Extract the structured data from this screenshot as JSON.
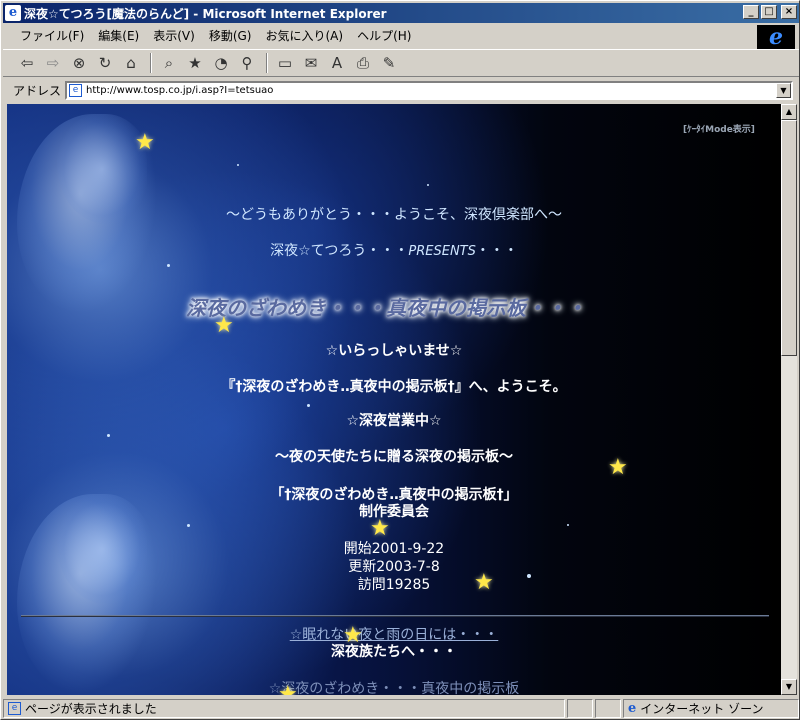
{
  "window": {
    "title": "深夜☆てつろう[魔法のらんど] - Microsoft Internet Explorer",
    "minimize": "_",
    "maximize": "□",
    "close": "×"
  },
  "menu": [
    "ファイル(F)",
    "編集(E)",
    "表示(V)",
    "移動(G)",
    "お気に入り(A)",
    "ヘルプ(H)"
  ],
  "toolbar_icons": [
    "back-icon",
    "forward-icon",
    "stop-icon",
    "refresh-icon",
    "home-icon",
    "search-icon",
    "favorites-icon",
    "history-icon",
    "channels-icon",
    "fullscreen-icon",
    "mail-icon",
    "font-icon",
    "print-icon",
    "edit-icon"
  ],
  "address": {
    "label": "アドレス",
    "url": "http://www.tosp.co.jp/i.asp?I=tetsuao"
  },
  "page": {
    "keitai_link": "[ｹｰﾀｲMode表示]",
    "greeting1": "～どうもありがとう・・・ようこそ、深夜倶楽部へ～",
    "greeting2_prefix": "深夜☆てつろう・・・",
    "greeting2_presents": "PRESENTS",
    "greeting2_suffix": "・・・",
    "title": "深夜のざわめき・・・真夜中の掲示板・・・",
    "welcome": "☆いらっしゃいませ☆",
    "intro": "『†深夜のざわめき‥真夜中の掲示板†』へ、ようこそ。",
    "open": "☆深夜営業中☆",
    "tagline": "～夜の天使たちに贈る深夜の掲示板～",
    "committee_line1": "「†深夜のざわめき‥真夜中の掲示板†」",
    "committee_line2": "制作委員会",
    "start": "開始2001-9-22",
    "update": "更新2003-7-8",
    "visits": "訪問19285",
    "link1": "☆眠れない夜と雨の日には・・・",
    "tribe": "深夜族たちへ・・・",
    "link2": "☆深夜のざわめき・・・真夜中の掲示板"
  },
  "status": {
    "message": "ページが表示されました",
    "zone": "インターネット ゾーン"
  },
  "colors": {
    "titlebar": "#0a246a",
    "star": "#ffe84a"
  }
}
